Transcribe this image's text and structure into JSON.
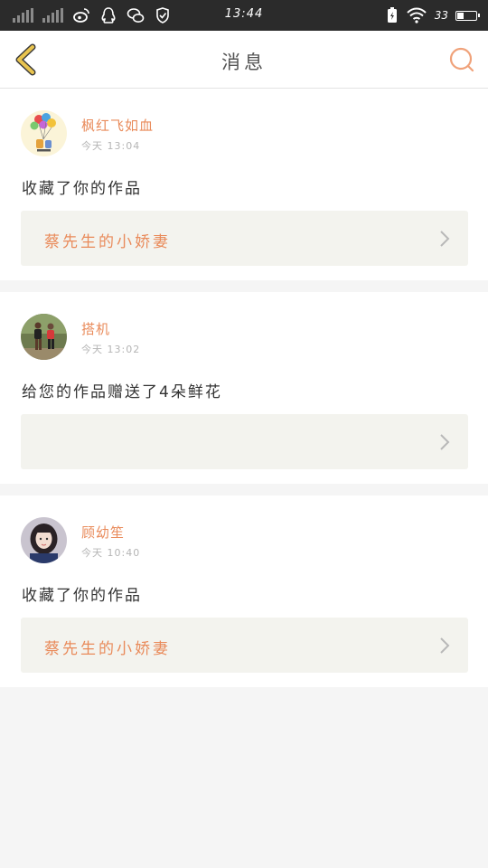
{
  "status_bar": {
    "time": "13:44",
    "battery_percent": "33",
    "icons": [
      "signal-icon",
      "signal-icon",
      "weibo-icon",
      "qq-icon",
      "wechat-icon",
      "shield-icon",
      "battery-saver-icon",
      "wifi-icon",
      "battery-icon"
    ]
  },
  "header": {
    "title": "消息",
    "back_icon": "chevron-left-icon",
    "search_icon": "search-icon"
  },
  "colors": {
    "accent": "#e98b5b",
    "back_arrow": "#e9c44f",
    "card_link_bg": "#f3f3ee"
  },
  "messages": [
    {
      "user": "枫红飞如血",
      "time": "今天 13:04",
      "action": "收藏了你的作品",
      "work": "蔡先生的小娇妻",
      "avatar": "balloons-avatar"
    },
    {
      "user": "搭机",
      "time": "今天 13:02",
      "action": "给您的作品赠送了4朵鲜花",
      "work": "",
      "avatar": "runners-avatar"
    },
    {
      "user": "顾幼笙",
      "time": "今天 10:40",
      "action": "收藏了你的作品",
      "work": "蔡先生的小娇妻",
      "avatar": "girl-avatar"
    }
  ]
}
